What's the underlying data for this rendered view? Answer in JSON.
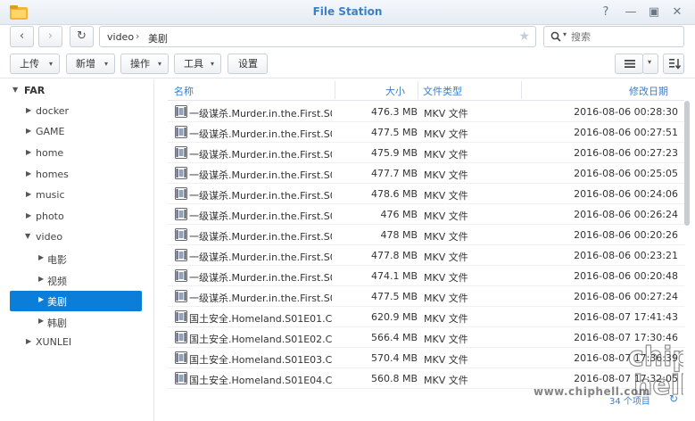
{
  "window": {
    "title": "File Station"
  },
  "colors": {
    "accent": "#0a7ed8",
    "header_text": "#3a7fc8"
  },
  "nav": {
    "path": [
      "video",
      "美剧"
    ],
    "search_placeholder": "搜索"
  },
  "toolbar": {
    "upload": "上传",
    "create": "新增",
    "action": "操作",
    "tools": "工具",
    "settings": "设置"
  },
  "sidebar": {
    "root": "FAR",
    "items": [
      {
        "label": "docker",
        "level": 1
      },
      {
        "label": "GAME",
        "level": 1
      },
      {
        "label": "home",
        "level": 1
      },
      {
        "label": "homes",
        "level": 1
      },
      {
        "label": "music",
        "level": 1
      },
      {
        "label": "photo",
        "level": 1
      },
      {
        "label": "video",
        "level": 1,
        "expanded": true
      },
      {
        "label": "电影",
        "level": 2
      },
      {
        "label": "视频",
        "level": 2
      },
      {
        "label": "美剧",
        "level": 2,
        "selected": true
      },
      {
        "label": "韩剧",
        "level": 2
      },
      {
        "label": "XUNLEI",
        "level": 1
      }
    ]
  },
  "table": {
    "headers": {
      "name": "名称",
      "size": "大小",
      "type": "文件类型",
      "modified": "修改日期"
    },
    "rows": [
      {
        "name": "一级谋杀.Murder.in.the.First.S0...",
        "size": "476.3 MB",
        "type": "MKV 文件",
        "modified": "2016-08-06 00:28:30"
      },
      {
        "name": "一级谋杀.Murder.in.the.First.S0...",
        "size": "477.5 MB",
        "type": "MKV 文件",
        "modified": "2016-08-06 00:27:51"
      },
      {
        "name": "一级谋杀.Murder.in.the.First.S0...",
        "size": "475.9 MB",
        "type": "MKV 文件",
        "modified": "2016-08-06 00:27:23"
      },
      {
        "name": "一级谋杀.Murder.in.the.First.S0...",
        "size": "477.7 MB",
        "type": "MKV 文件",
        "modified": "2016-08-06 00:25:05"
      },
      {
        "name": "一级谋杀.Murder.in.the.First.S0...",
        "size": "478.6 MB",
        "type": "MKV 文件",
        "modified": "2016-08-06 00:24:06"
      },
      {
        "name": "一级谋杀.Murder.in.the.First.S0...",
        "size": "476 MB",
        "type": "MKV 文件",
        "modified": "2016-08-06 00:26:24"
      },
      {
        "name": "一级谋杀.Murder.in.the.First.S0...",
        "size": "478 MB",
        "type": "MKV 文件",
        "modified": "2016-08-06 00:20:26"
      },
      {
        "name": "一级谋杀.Murder.in.the.First.S0...",
        "size": "477.8 MB",
        "type": "MKV 文件",
        "modified": "2016-08-06 00:23:21"
      },
      {
        "name": "一级谋杀.Murder.in.the.First.S0...",
        "size": "474.1 MB",
        "type": "MKV 文件",
        "modified": "2016-08-06 00:20:48"
      },
      {
        "name": "一级谋杀.Murder.in.the.First.S0...",
        "size": "477.5 MB",
        "type": "MKV 文件",
        "modified": "2016-08-06 00:27:24"
      },
      {
        "name": "国土安全.Homeland.S01E01.C...",
        "size": "620.9 MB",
        "type": "MKV 文件",
        "modified": "2016-08-07 17:41:43"
      },
      {
        "name": "国土安全.Homeland.S01E02.C...",
        "size": "566.4 MB",
        "type": "MKV 文件",
        "modified": "2016-08-07 17:30:46"
      },
      {
        "name": "国土安全.Homeland.S01E03.C...",
        "size": "570.4 MB",
        "type": "MKV 文件",
        "modified": "2016-08-07 17:36:39"
      },
      {
        "name": "国土安全.Homeland.S01E04.C...",
        "size": "560.8 MB",
        "type": "MKV 文件",
        "modified": "2016-08-07 17:32:05"
      }
    ]
  },
  "footer": {
    "count": "34 个项目"
  },
  "watermark": {
    "text": "www.chiphell.com"
  }
}
